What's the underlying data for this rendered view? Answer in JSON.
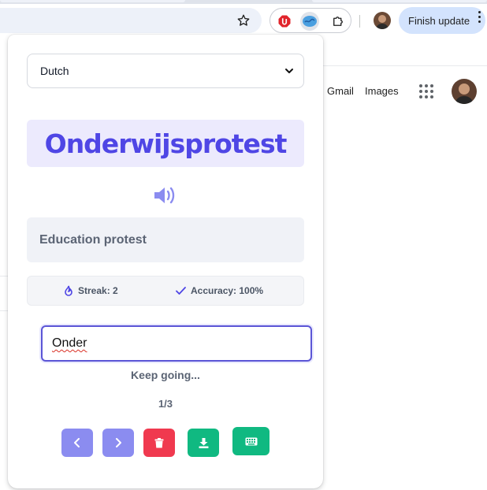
{
  "browser": {
    "toolbar": {
      "bookmark_icon": "star-icon",
      "extensions": [
        "adblock-icon",
        "language-extension-icon",
        "puzzle-icon"
      ],
      "finish_update_label": "Finish update"
    }
  },
  "google_page": {
    "links": [
      "Gmail",
      "Images"
    ]
  },
  "popup": {
    "language_select": {
      "value": "Dutch"
    },
    "word": "Onderwijsprotest",
    "translation": "Education protest",
    "stats": {
      "streak_label": "Streak: 2",
      "accuracy_label": "Accuracy: 100%"
    },
    "answer_input": {
      "value": "Onder"
    },
    "feedback": "Keep going...",
    "progress": "1/3",
    "buttons": [
      "previous",
      "next",
      "delete",
      "download",
      "keyboard"
    ],
    "colors": {
      "accent": "#4f46e5",
      "word_bg": "#eceafd",
      "nav_button": "#8b8cf0",
      "delete_button": "#f0394f",
      "action_button": "#10b981"
    }
  }
}
